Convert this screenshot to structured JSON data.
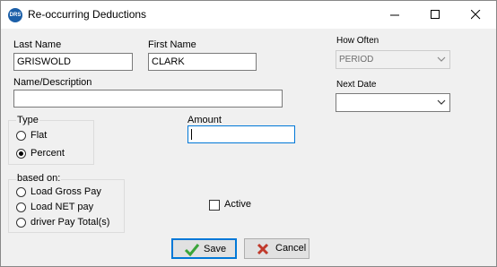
{
  "window": {
    "title": "Re-occurring Deductions",
    "app_icon_text": "DRS",
    "controls": [
      "minimize",
      "maximize",
      "close"
    ]
  },
  "form": {
    "last_name_label": "Last Name",
    "last_name_value": "GRISWOLD",
    "first_name_label": "First Name",
    "first_name_value": "CLARK",
    "name_description_label": "Name/Description",
    "name_description_value": "",
    "how_often_label": "How Often",
    "how_often_value": "PERIOD",
    "next_date_label": "Next Date",
    "next_date_value": "",
    "type_label": "Type",
    "type_options": [
      "Flat",
      "Percent"
    ],
    "type_selected": "Percent",
    "amount_label": "Amount",
    "amount_value": "",
    "based_on_label": "based on:",
    "based_on_options": [
      "Load Gross Pay",
      "Load NET pay",
      "driver Pay Total(s)"
    ],
    "based_on_selected": "",
    "active_label": "Active",
    "active_checked": false
  },
  "buttons": {
    "save_label": "Save",
    "cancel_label": "Cancel"
  },
  "colors": {
    "accent": "#0078d7",
    "save_icon": "#3aa53a",
    "cancel_icon": "#c0392b"
  }
}
